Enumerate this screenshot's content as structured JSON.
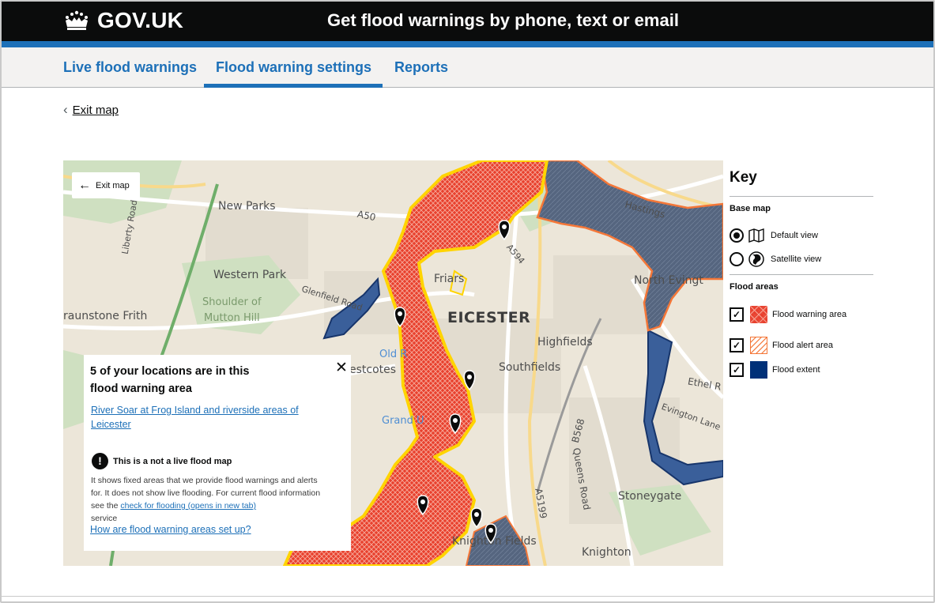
{
  "header": {
    "logo_text": "GOV.UK",
    "service_name": "Get flood warnings by phone, text or email"
  },
  "nav": {
    "items": [
      {
        "label": "Live flood warnings",
        "active": false
      },
      {
        "label": "Flood warning settings",
        "active": true
      },
      {
        "label": "Reports",
        "active": false
      }
    ]
  },
  "back_link": {
    "label": "Exit map",
    "icon": "chevron-left-icon"
  },
  "map": {
    "exit_button": {
      "label": "Exit map",
      "icon": "arrow-left-icon"
    },
    "labels": {
      "new_parks": "New Parks",
      "western_park": "Western Park",
      "shoulder": "Shoulder of",
      "mutton_hill": "Mutton Hill",
      "braunstone": "raunstone Frith",
      "leicester": "EICESTER",
      "friars": "Friars",
      "highfields": "Highfields",
      "southfields": "Southfields",
      "north_evington": "North Evingt",
      "stoneygate": "Stoneygate",
      "knighton": "Knighton",
      "knighton_fields": "Knighton Fields",
      "westcotes": "estcotes",
      "old_r": "Old R",
      "grand_u": "Grand U",
      "a50": "A50",
      "a594": "A594",
      "a5199": "A5199",
      "b568": "B568",
      "queens_road": "Queens Road",
      "hastings": "Hastings",
      "glenfield": "Glenfield Road",
      "liberty": "Liberty Road",
      "ethel": "Ethel R",
      "evington_lane": "Evington Lane"
    },
    "location_pin_count": 7
  },
  "popup": {
    "title": "5 of your locations are in this flood warning  area",
    "area_link": "River Soar at Frog Island and riverside areas of Leicester",
    "warning_title": "This is a not a live flood map",
    "warning_body_1": "It shows fixed areas that we provide flood warnings and alerts for. It does not show live flooding. For current flood information see the",
    "warning_link": "check for flooding (opens in new tab)",
    "warning_body_2": "service",
    "help_link": "How are flood warning areas set up?"
  },
  "key": {
    "title": "Key",
    "base_map_heading": "Base map",
    "base_map_options": [
      {
        "label": "Default view",
        "selected": true,
        "icon": "map-icon"
      },
      {
        "label": "Satellite view",
        "selected": false,
        "icon": "globe-icon"
      }
    ],
    "flood_areas_heading": "Flood areas",
    "flood_areas": [
      {
        "label": "Flood warning area",
        "checked": true,
        "color": "#e8402d"
      },
      {
        "label": "Flood alert area",
        "checked": true,
        "color": "#f47738"
      },
      {
        "label": "Flood extent",
        "checked": true,
        "color": "#003078"
      }
    ]
  },
  "colors": {
    "brand_blue": "#1d70b8",
    "header_black": "#0b0c0c",
    "warning_red": "#e8402d",
    "alert_orange": "#f47738",
    "extent_navy": "#003078"
  }
}
